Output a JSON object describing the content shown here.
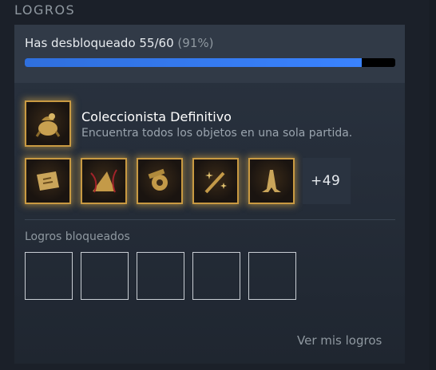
{
  "section": {
    "title": "LOGROS"
  },
  "progress": {
    "label": "Has desbloqueado 55/60",
    "percent_text": "(91%)",
    "fraction": 0.91
  },
  "featured": {
    "name": "Coleccionista Definitivo",
    "description": "Encuentra todos los objetos en una sola partida.",
    "icon": "treasure-sack-icon"
  },
  "unlocked_icons": [
    {
      "icon": "scroll-map-icon"
    },
    {
      "icon": "witch-hat-icon"
    },
    {
      "icon": "broken-gear-icon"
    },
    {
      "icon": "magic-wand-icon"
    },
    {
      "icon": "praying-hands-icon"
    }
  ],
  "more_count": "+49",
  "locked": {
    "label": "Logros bloqueados",
    "slots": 5
  },
  "view_link": "Ver mis logros",
  "colors": {
    "accent_blue": "#3a83ff",
    "gold_glow": "#c99a42",
    "panel": "#2a3340"
  }
}
